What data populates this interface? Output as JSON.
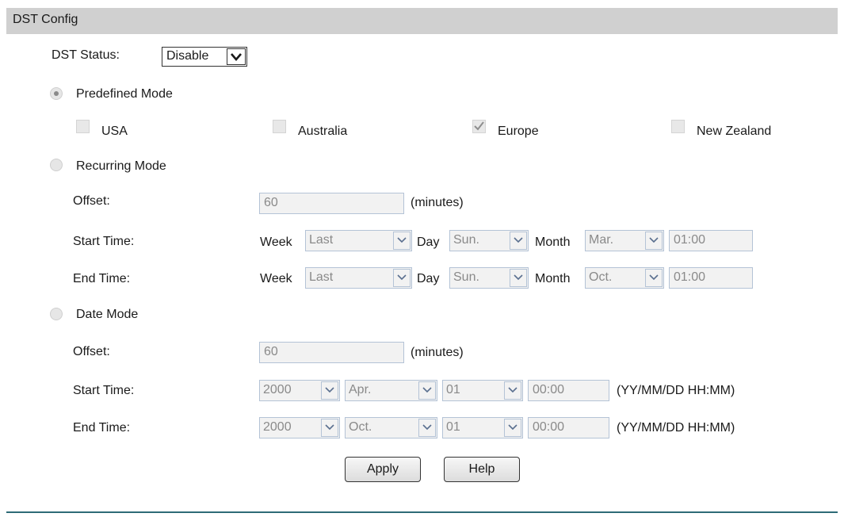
{
  "header": {
    "title": "DST Config"
  },
  "status": {
    "label": "DST Status:",
    "value": "Disable"
  },
  "predefined": {
    "label": "Predefined Mode",
    "selected": true,
    "options": [
      {
        "label": "USA",
        "checked": false
      },
      {
        "label": "Australia",
        "checked": false
      },
      {
        "label": "Europe",
        "checked": true
      },
      {
        "label": "New Zealand",
        "checked": false
      }
    ]
  },
  "recurring": {
    "label": "Recurring Mode",
    "selected": false,
    "offset_label": "Offset:",
    "offset_value": "60",
    "offset_unit": "(minutes)",
    "start": {
      "label": "Start Time:",
      "week_label": "Week",
      "week": "Last",
      "day_label": "Day",
      "day": "Sun.",
      "month_label": "Month",
      "month": "Mar.",
      "time": "01:00"
    },
    "end": {
      "label": "End Time:",
      "week_label": "Week",
      "week": "Last",
      "day_label": "Day",
      "day": "Sun.",
      "month_label": "Month",
      "month": "Oct.",
      "time": "01:00"
    }
  },
  "date": {
    "label": "Date Mode",
    "selected": false,
    "offset_label": "Offset:",
    "offset_value": "60",
    "offset_unit": "(minutes)",
    "start": {
      "label": "Start Time:",
      "year": "2000",
      "month": "Apr.",
      "day": "01",
      "time": "00:00",
      "format": "(YY/MM/DD HH:MM)"
    },
    "end": {
      "label": "End Time:",
      "year": "2000",
      "month": "Oct.",
      "day": "01",
      "time": "00:00",
      "format": "(YY/MM/DD HH:MM)"
    }
  },
  "buttons": {
    "apply": "Apply",
    "help": "Help"
  },
  "colors": {
    "header_bg": "#d0d0d0",
    "bottom_rule": "#2e6b77",
    "disabled_border": "#b4c3d6"
  }
}
